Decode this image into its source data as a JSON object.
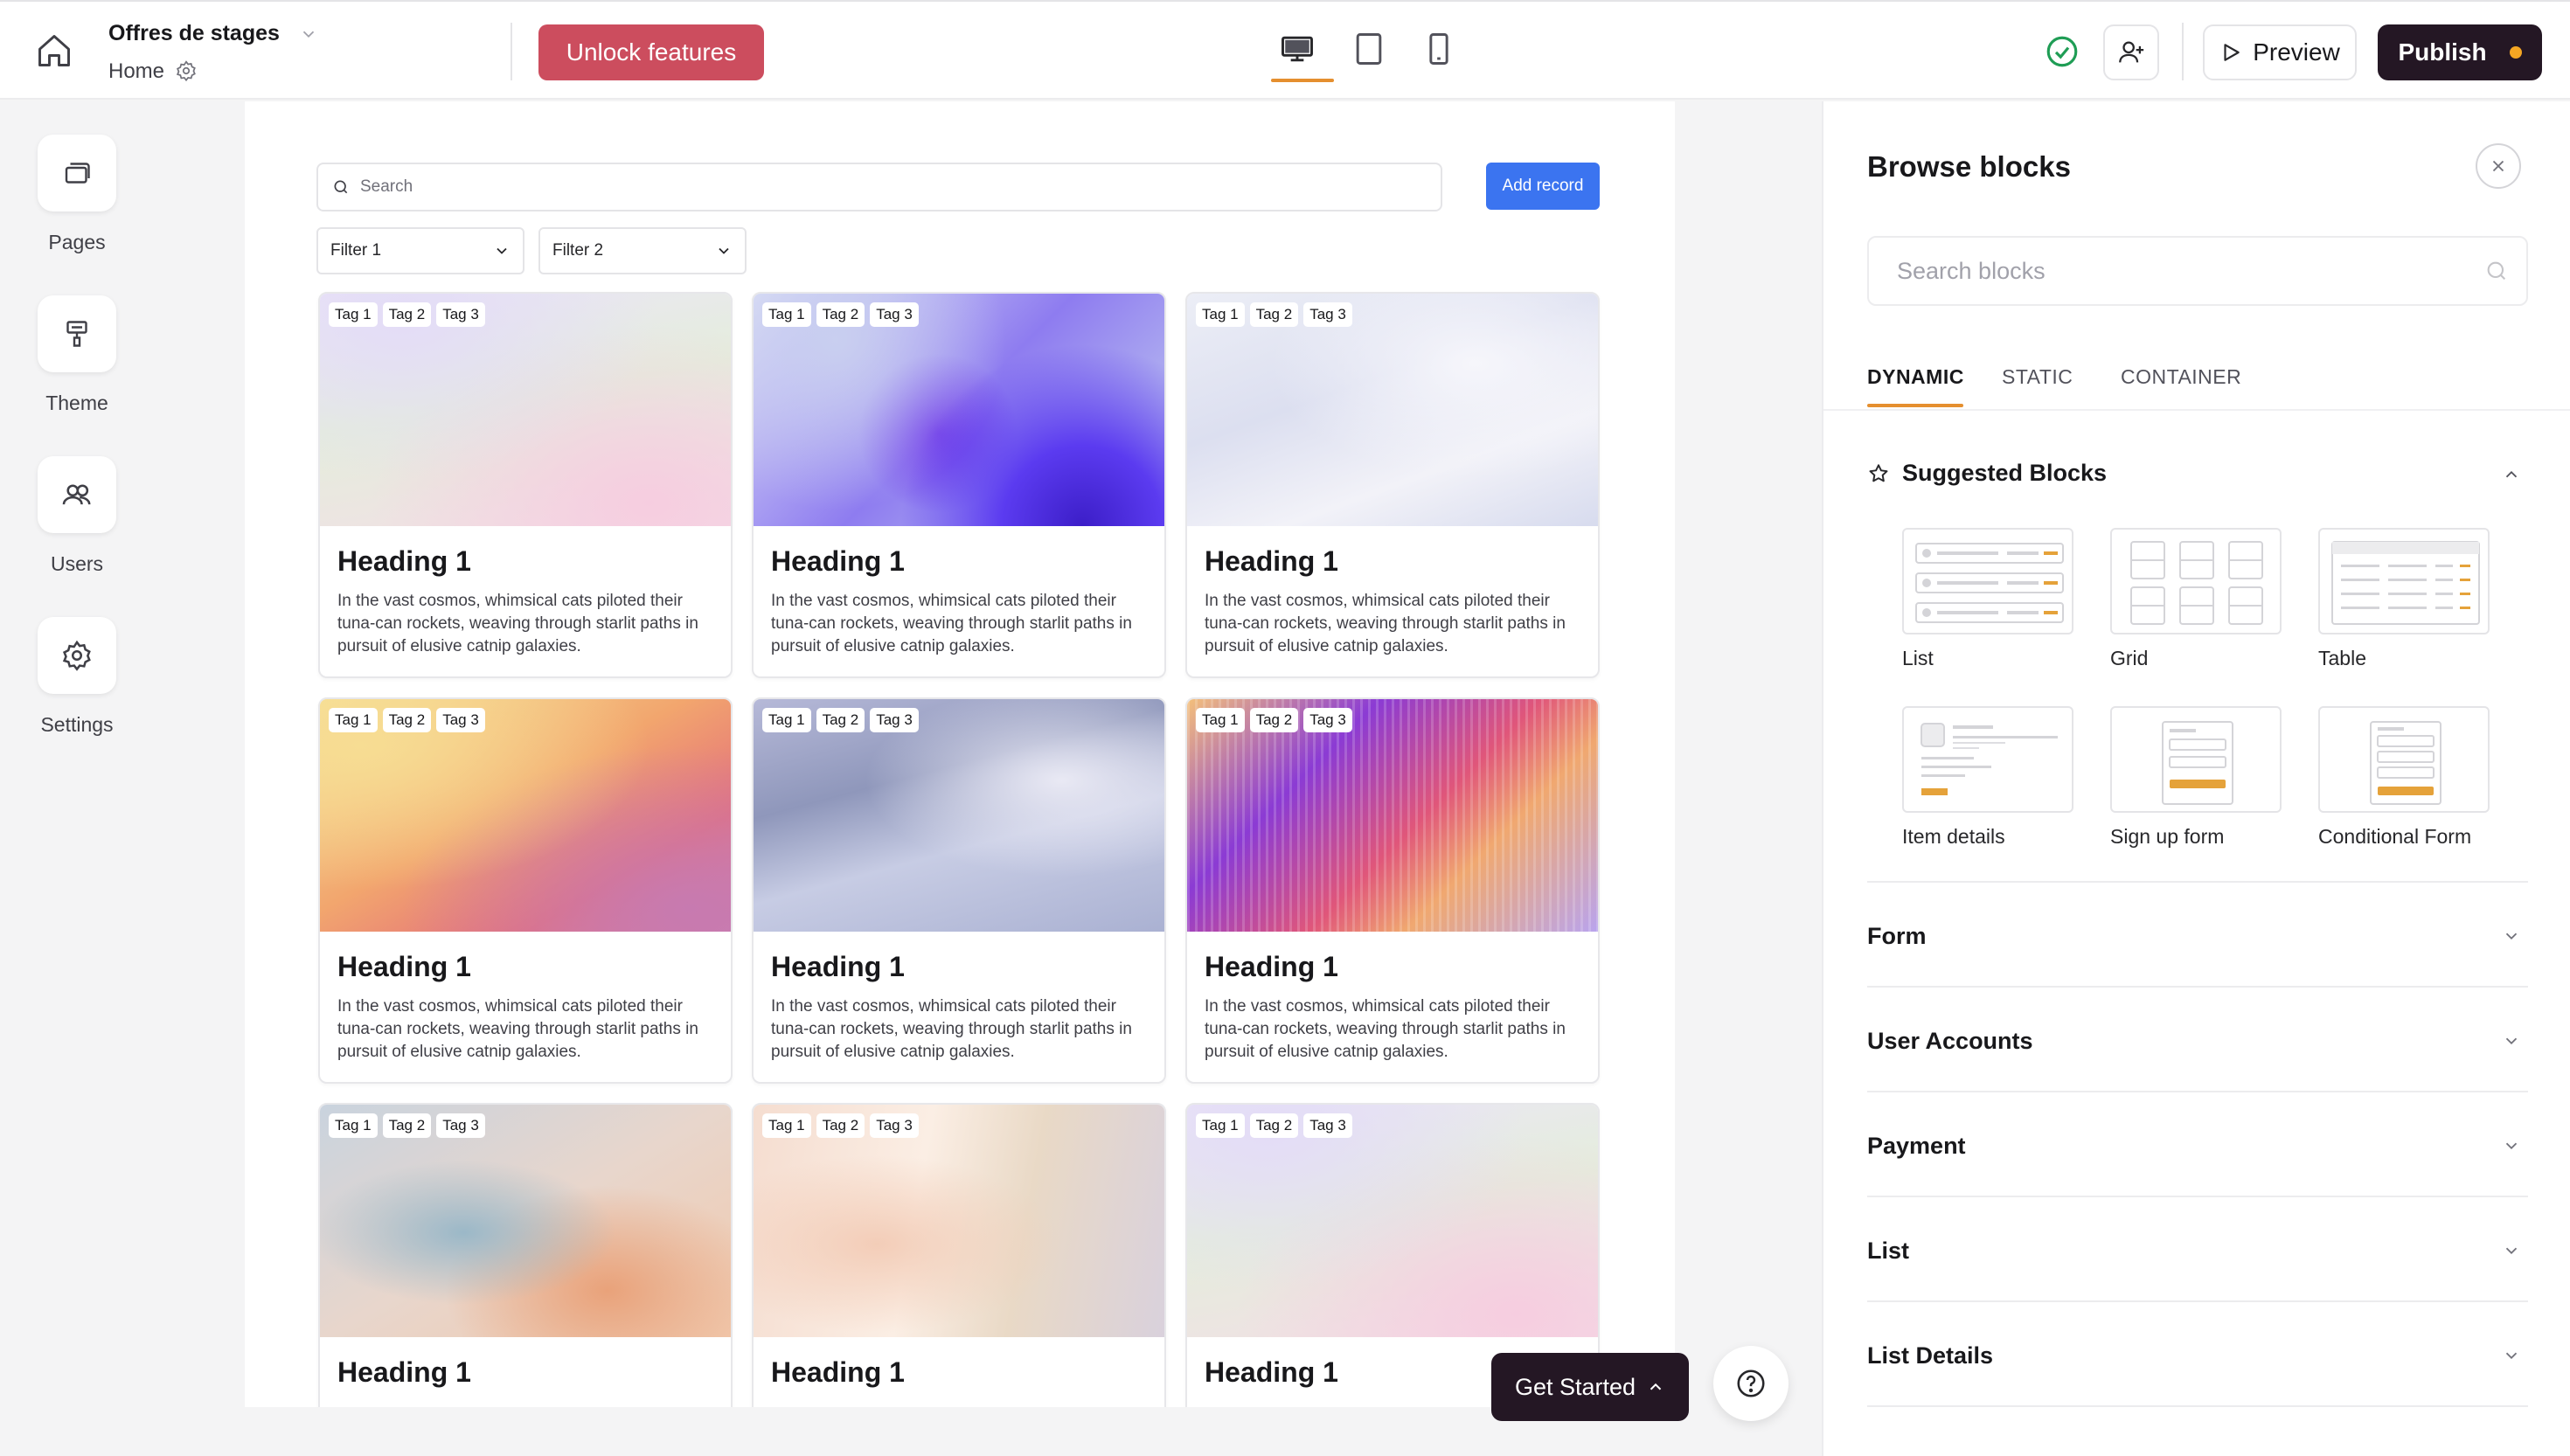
{
  "header": {
    "site_name": "Offres de stages",
    "page_name": "Home",
    "unlock_label": "Unlock features",
    "preview_label": "Preview",
    "publish_label": "Publish",
    "colors": {
      "unlock": "#cc4d5e",
      "publish": "#241724",
      "accent": "#e58f2f",
      "status_ok": "#1f9d55"
    }
  },
  "sidebar": {
    "items": [
      {
        "label": "Pages",
        "icon": "pages-icon"
      },
      {
        "label": "Theme",
        "icon": "paint-roller-icon"
      },
      {
        "label": "Users",
        "icon": "users-icon"
      },
      {
        "label": "Settings",
        "icon": "gear-icon"
      }
    ]
  },
  "canvas": {
    "search_placeholder": "Search",
    "add_record_label": "Add record",
    "filters": [
      "Filter 1",
      "Filter 2"
    ],
    "cards": [
      {
        "tags": [
          "Tag 1",
          "Tag 2",
          "Tag 3"
        ],
        "heading": "Heading 1",
        "text": "In the vast cosmos, whimsical cats piloted their tuna-can rockets, weaving through starlit paths in pursuit of elusive catnip galaxies."
      },
      {
        "tags": [
          "Tag 1",
          "Tag 2",
          "Tag 3"
        ],
        "heading": "Heading 1",
        "text": "In the vast cosmos, whimsical cats piloted their tuna-can rockets, weaving through starlit paths in pursuit of elusive catnip galaxies."
      },
      {
        "tags": [
          "Tag 1",
          "Tag 2",
          "Tag 3"
        ],
        "heading": "Heading 1",
        "text": "In the vast cosmos, whimsical cats piloted their tuna-can rockets, weaving through starlit paths in pursuit of elusive catnip galaxies."
      },
      {
        "tags": [
          "Tag 1",
          "Tag 2",
          "Tag 3"
        ],
        "heading": "Heading 1",
        "text": "In the vast cosmos, whimsical cats piloted their tuna-can rockets, weaving through starlit paths in pursuit of elusive catnip galaxies."
      },
      {
        "tags": [
          "Tag 1",
          "Tag 2",
          "Tag 3"
        ],
        "heading": "Heading 1",
        "text": "In the vast cosmos, whimsical cats piloted their tuna-can rockets, weaving through starlit paths in pursuit of elusive catnip galaxies."
      },
      {
        "tags": [
          "Tag 1",
          "Tag 2",
          "Tag 3"
        ],
        "heading": "Heading 1",
        "text": "In the vast cosmos, whimsical cats piloted their tuna-can rockets, weaving through starlit paths in pursuit of elusive catnip galaxies."
      },
      {
        "tags": [
          "Tag 1",
          "Tag 2",
          "Tag 3"
        ],
        "heading": "Heading 1",
        "text": ""
      },
      {
        "tags": [
          "Tag 1",
          "Tag 2",
          "Tag 3"
        ],
        "heading": "Heading 1",
        "text": ""
      },
      {
        "tags": [
          "Tag 1",
          "Tag 2",
          "Tag 3"
        ],
        "heading": "Heading 1",
        "text": ""
      }
    ]
  },
  "floating": {
    "get_started_label": "Get Started"
  },
  "panel": {
    "title": "Browse blocks",
    "search_placeholder": "Search blocks",
    "tabs": [
      "DYNAMIC",
      "STATIC",
      "CONTAINER"
    ],
    "active_tab": "DYNAMIC",
    "suggested_title": "Suggested Blocks",
    "suggested_blocks": [
      "List",
      "Grid",
      "Table",
      "Item details",
      "Sign up form",
      "Conditional Form"
    ],
    "sections": [
      "Form",
      "User Accounts",
      "Payment",
      "List",
      "List Details"
    ]
  }
}
